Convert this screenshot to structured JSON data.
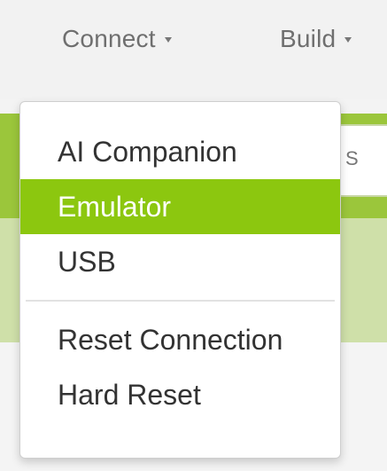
{
  "menu": {
    "connect_label": "Connect",
    "build_label": "Build"
  },
  "background": {
    "input_fragment": "S"
  },
  "dropdown": {
    "items": [
      {
        "label": "AI Companion"
      },
      {
        "label": "Emulator",
        "state": "highlighted"
      },
      {
        "label": "USB"
      },
      {
        "label": "Reset Connection"
      },
      {
        "label": "Hard Reset"
      }
    ]
  },
  "colors": {
    "highlight": "#8cc70f",
    "toolbar_green": "#9bc63b",
    "menu_text": "#6f6f6f"
  },
  "icons": {
    "menu_caret": "chevron-down-icon"
  }
}
